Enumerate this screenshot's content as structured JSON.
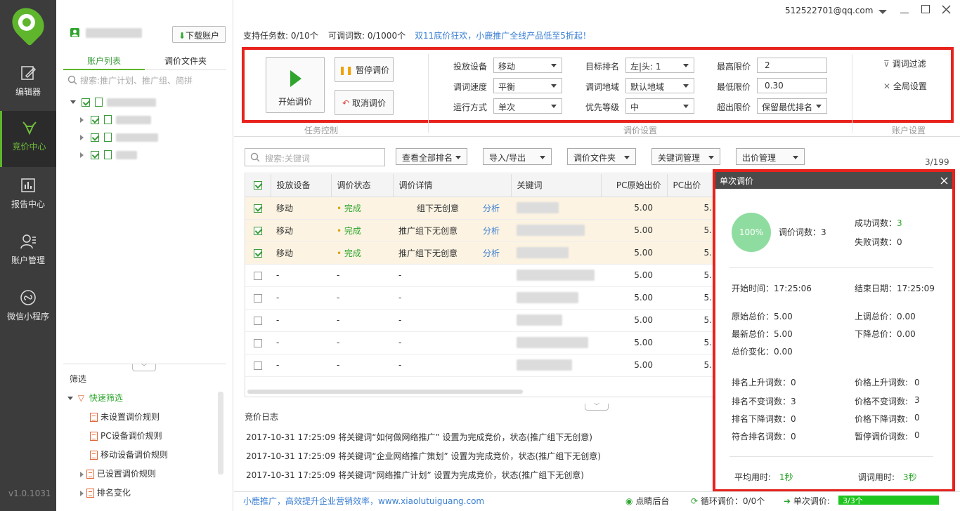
{
  "nav": {
    "items": [
      {
        "label": "编辑器"
      },
      {
        "label": "竞价中心"
      },
      {
        "label": "报告中心"
      },
      {
        "label": "账户管理"
      },
      {
        "label": "微信小程序"
      }
    ],
    "version": "v1.0.1031"
  },
  "account": {
    "download_label": "下载账户",
    "tabs": [
      "账户列表",
      "调价文件夹"
    ],
    "search_placeholder": "搜索:推广计划、推广组、简拼"
  },
  "filter": {
    "title": "筛选",
    "quick": "快速筛选",
    "items": [
      "未设置调价规则",
      "PC设备调价规则",
      "移动设备调价规则",
      "已设置调价规则",
      "排名变化"
    ]
  },
  "window": {
    "user": "512522701@qq.com"
  },
  "top": {
    "tasks": "支持任务数: 0/10个",
    "words": "可调词数: 0/1000个",
    "promo": "双11底价狂欢，小鹿推广全线产品低至5折起！"
  },
  "task": {
    "start": "开始调价",
    "pause": "暂停调价",
    "cancel": "取消调价",
    "section": "任务控制"
  },
  "settings": {
    "device_label": "投放设备",
    "device": "移动",
    "speed_label": "调词速度",
    "speed": "平衡",
    "mode_label": "运行方式",
    "mode": "单次",
    "rank_label": "目标排名",
    "rank": "左|头: 1",
    "region_label": "调词地域",
    "region": "默认地域",
    "priority_label": "优先等级",
    "priority": "中",
    "max_label": "最高限价",
    "max": "2",
    "min_label": "最低限价",
    "min": "0.30",
    "over_label": "超出限价",
    "over": "保留最优排名",
    "section": "调价设置"
  },
  "account_settings": {
    "filter": "调词过滤",
    "global": "全局设置",
    "section": "账户设置"
  },
  "toolbar": {
    "search_placeholder": "搜索:关键词",
    "view_all": "查看全部排名",
    "import_export": "导入/导出",
    "folder": "调价文件夹",
    "kw_manage": "关键词管理",
    "bid_manage": "出价管理",
    "count": "3/199"
  },
  "table": {
    "headers": [
      "投放设备",
      "调价状态",
      "调价详情",
      "关键词",
      "PC原始出价",
      "PC出价"
    ],
    "rows": [
      {
        "device": "移动",
        "status": "完成",
        "detail": "组下无创意",
        "analyze": "分析",
        "pc_orig": "5.00",
        "pc_bid": "5.",
        "checked": true
      },
      {
        "device": "移动",
        "status": "完成",
        "detail": "推广组下无创意",
        "analyze": "分析",
        "pc_orig": "5.00",
        "pc_bid": "5.",
        "checked": true
      },
      {
        "device": "移动",
        "status": "完成",
        "detail": "推广组下无创意",
        "analyze": "分析",
        "pc_orig": "5.00",
        "pc_bid": "5.",
        "checked": true
      },
      {
        "device": "-",
        "status": "-",
        "detail": "-",
        "analyze": "",
        "pc_orig": "5.00",
        "pc_bid": "5.",
        "checked": false
      },
      {
        "device": "-",
        "status": "-",
        "detail": "-",
        "analyze": "",
        "pc_orig": "5.00",
        "pc_bid": "5.",
        "checked": false
      },
      {
        "device": "-",
        "status": "-",
        "detail": "-",
        "analyze": "",
        "pc_orig": "5.00",
        "pc_bid": "5.",
        "checked": false
      },
      {
        "device": "-",
        "status": "-",
        "detail": "-",
        "analyze": "",
        "pc_orig": "5.00",
        "pc_bid": "5.",
        "checked": false
      },
      {
        "device": "-",
        "status": "-",
        "detail": "-",
        "analyze": "",
        "pc_orig": "5.00",
        "pc_bid": "5.",
        "checked": false
      }
    ]
  },
  "log": {
    "title": "竞价日志",
    "lines": [
      "2017-10-31 17:25:09 将关键词“如何做网络推广” 设置为完成竞价，状态(推广组下无创意)",
      "2017-10-31 17:25:09 将关键词“企业网络推广策划” 设置为完成竞价，状态(推广组下无创意)",
      "2017-10-31 17:25:09 将关键词“网络推广计划” 设置为完成竞价，状态(推广组下无创意)"
    ]
  },
  "popup": {
    "title": "单次调价",
    "percent": "100%",
    "count": "调价词数：3",
    "success_label": "成功词数：",
    "success": "3",
    "fail": "失败词数：0",
    "start": "开始时间：17:25:06",
    "end": "结束日期：17:25:09",
    "orig_total": "原始总价：5.00",
    "up_total": "上调总价：0.00",
    "new_total": "最新总价：5.00",
    "down_total": "下降总价：0.00",
    "change": "总价变化：0.00",
    "rank_up": "排名上升词数：0",
    "rank_same": "排名不变词数：3",
    "rank_down": "排名下降词数：0",
    "rank_ok": "符合排名词数：0",
    "price_up_label": "价格上升词数:",
    "price_up": "0",
    "price_same_label": "价格不变词数:",
    "price_same": "3",
    "price_down_label": "价格下降词数:",
    "price_down": "0",
    "pause_label": "暂停调价词数:",
    "pause": "0",
    "avg_label": "平均用时:",
    "avg": "1秒",
    "total_label": "调词用时:",
    "total": "3秒"
  },
  "status": {
    "slogan": "小鹿推广，高效提升企业营销效率，www.xiaolutuiguang.com",
    "eye": "点睛后台",
    "loop": "循环调价：0/0个",
    "single": "单次调价:",
    "single_progress": "3/3个",
    "single_fraction": 1.0
  },
  "colors": {
    "accent": "#5fb62d",
    "highlight": "#e8221c",
    "link": "#3b7fd3"
  }
}
